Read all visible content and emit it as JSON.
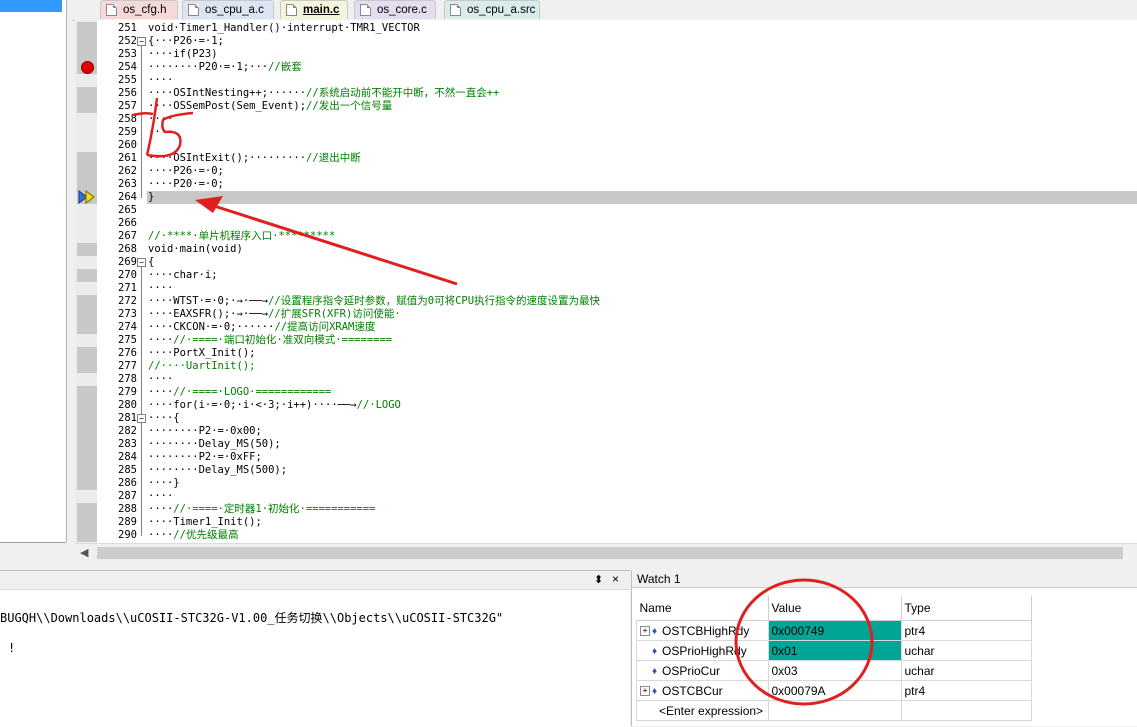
{
  "tabs": [
    {
      "label": "os_cfg.h",
      "color": "c-red"
    },
    {
      "label": "os_cpu_a.c",
      "color": "c-blue"
    },
    {
      "label": "main.c",
      "color": "active"
    },
    {
      "label": "os_core.c",
      "color": "c-purple"
    },
    {
      "label": "os_cpu_a.src",
      "color": "c-teal"
    }
  ],
  "editor": {
    "lines": [
      {
        "n": "251",
        "code": "void·Timer1_Handler()·interrupt·TMR1_VECTOR"
      },
      {
        "n": "252",
        "code": "{···P26·=·1;"
      },
      {
        "n": "253",
        "code": "····if(P23)"
      },
      {
        "n": "254",
        "code": "········P20·=·1;···//嵌套"
      },
      {
        "n": "255",
        "code": "····"
      },
      {
        "n": "256",
        "code": "····OSIntNesting++;······//系统启动前不能开中断，不然一直会++"
      },
      {
        "n": "257",
        "code": "····OSSemPost(Sem_Event);//发出一个信号量"
      },
      {
        "n": "258",
        "code": "····"
      },
      {
        "n": "259",
        "code": "····"
      },
      {
        "n": "260",
        "code": ""
      },
      {
        "n": "261",
        "code": "····OSIntExit();·········//退出中断"
      },
      {
        "n": "262",
        "code": "····P26·=·0;"
      },
      {
        "n": "263",
        "code": "····P20·=·0;"
      },
      {
        "n": "264",
        "code": "}"
      },
      {
        "n": "265",
        "code": ""
      },
      {
        "n": "266",
        "code": ""
      },
      {
        "n": "267",
        "code": "//·****·单片机程序入口·*********"
      },
      {
        "n": "268",
        "code": "void·main(void)"
      },
      {
        "n": "269",
        "code": "{"
      },
      {
        "n": "270",
        "code": "····char·i;"
      },
      {
        "n": "271",
        "code": "····"
      },
      {
        "n": "272",
        "code": "····WTST·=·0;·→·──→//设置程序指令延时参数，赋值为0可将CPU执行指令的速度设置为最快"
      },
      {
        "n": "273",
        "code": "····EAXSFR();·→·──→//扩展SFR(XFR)访问使能·"
      },
      {
        "n": "274",
        "code": "····CKCON·=·0;······//提高访问XRAM速度"
      },
      {
        "n": "275",
        "code": "····//·====·端口初始化·准双向模式·========"
      },
      {
        "n": "276",
        "code": "····PortX_Init();"
      },
      {
        "n": "277",
        "code": "//····UartInit();"
      },
      {
        "n": "278",
        "code": "····"
      },
      {
        "n": "279",
        "code": "····//·====·LOGO·============"
      },
      {
        "n": "280",
        "code": "····for(i·=·0;·i·<·3;·i++)····──→//·LOGO"
      },
      {
        "n": "281",
        "code": "····{"
      },
      {
        "n": "282",
        "code": "········P2·=·0x00;"
      },
      {
        "n": "283",
        "code": "········Delay_MS(50);"
      },
      {
        "n": "284",
        "code": "········P2·=·0xFF;"
      },
      {
        "n": "285",
        "code": "········Delay_MS(500);"
      },
      {
        "n": "286",
        "code": "····}"
      },
      {
        "n": "287",
        "code": "····"
      },
      {
        "n": "288",
        "code": "····//·====·定时器1·初始化·==========="
      },
      {
        "n": "289",
        "code": "····Timer1_Init();"
      },
      {
        "n": "290",
        "code": "····//优先级最高"
      }
    ]
  },
  "output": {
    "line1": "BUGQH\\\\Downloads\\\\uCOSII-STC32G-V1.00_任务切换\\\\Objects\\\\uCOSII-STC32G\"",
    "line2": "!",
    "pin": "⬍",
    "close": "×"
  },
  "watch": {
    "title": "Watch 1",
    "headers": [
      "Name",
      "Value",
      "Type"
    ],
    "rows": [
      {
        "expand": "+",
        "name": "OSTCBHighRdy",
        "value": "0x000749",
        "type": "ptr4",
        "hl": true
      },
      {
        "expand": "",
        "name": "OSPrioHighRdy",
        "value": "0x01",
        "type": "uchar",
        "hl": true
      },
      {
        "expand": "",
        "name": "OSPrioCur",
        "value": "0x03",
        "type": "uchar",
        "hl": false
      },
      {
        "expand": "+",
        "name": "OSTCBCur",
        "value": "0x00079A",
        "type": "ptr4",
        "hl": false
      }
    ],
    "enter_expression": "<Enter expression>"
  },
  "annotation": {
    "handwritten": "15",
    "color": "#e02020"
  }
}
